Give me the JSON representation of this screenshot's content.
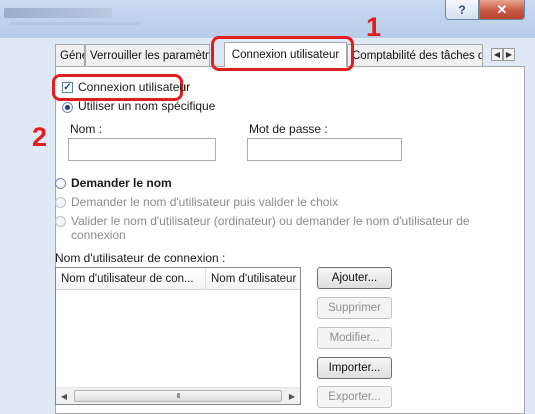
{
  "window": {
    "help_label": "?",
    "close_label": "✕"
  },
  "tabs": [
    {
      "label": "Général"
    },
    {
      "label": "Verrouiller les paramètres"
    },
    {
      "label": "Connexion utilisateur"
    },
    {
      "label": "Comptabilité des tâches d'i"
    }
  ],
  "tab_scroll": {
    "left": "◀",
    "right": "▶"
  },
  "login": {
    "enable_checkbox_label": "Connexion utilisateur",
    "enable_checked": true,
    "specific_name_radio_label": "Utiliser un nom spécifique",
    "name_label": "Nom :",
    "name_value": "",
    "password_label": "Mot de passe :",
    "password_value": "",
    "ask_name_radio_label": "Demander le nom",
    "ask_name_select_label": "Demander le nom d'utilisateur puis valider le choix",
    "validate_or_ask_line1": "Valider le nom d'utilisateur (ordinateur) ou demander le nom d'utilisateur de",
    "validate_or_ask_line2": "connexion"
  },
  "login_names": {
    "section_label": "Nom d'utilisateur de connexion :",
    "columns": [
      "Nom d'utilisateur de con...",
      "Nom d'utilisateur p"
    ],
    "scroll_left": "◀",
    "scroll_right": "▶",
    "scroll_thumb": "III"
  },
  "buttons": {
    "add": "Ajouter...",
    "delete": "Supprimer",
    "edit": "Modifier...",
    "import": "Importer...",
    "export": "Exporter..."
  },
  "callouts": {
    "step1": "1",
    "step2": "2"
  },
  "colors": {
    "callout": "#e01e1e",
    "panel": "#ffffff",
    "chrome": "#dfe9f5"
  }
}
